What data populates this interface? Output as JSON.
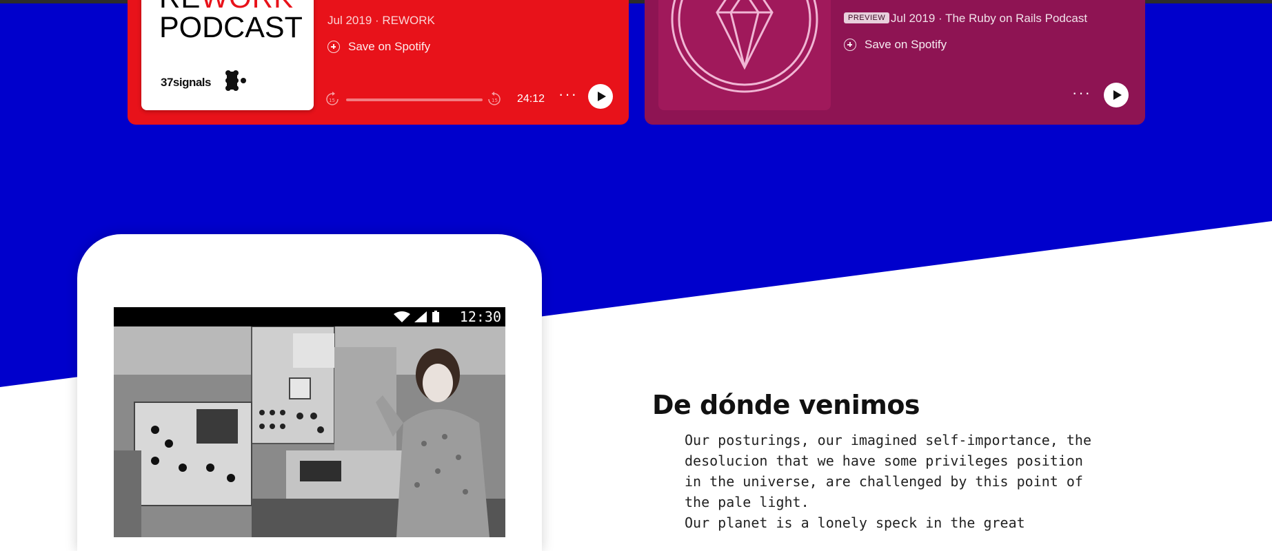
{
  "colors": {
    "blue": "#0000cc",
    "rework_red": "#e8121a",
    "ruby_magenta": "#8e1453"
  },
  "episodes": [
    {
      "cover": {
        "title_line1_a": "RE",
        "title_line1_b": "WORK",
        "title_line2": "PODCAST",
        "brand": "37signals"
      },
      "meta": "Jul 2019 · REWORK",
      "save_label": "Save on Spotify",
      "time": "24:12",
      "more": "···"
    },
    {
      "badge": "PREVIEW",
      "meta": "Jul 2019 · The Ruby on Rails Podcast",
      "save_label": "Save on Spotify",
      "more": "···"
    }
  ],
  "phone": {
    "status_time": "12:30"
  },
  "section": {
    "heading": "De dónde venimos",
    "body": "Our posturings, our imagined self-importance, the\ndesolucion that we have some privileges position\nin the universe, are challenged by this point of\nthe pale light.\nOur planet is a lonely speck in the great"
  }
}
